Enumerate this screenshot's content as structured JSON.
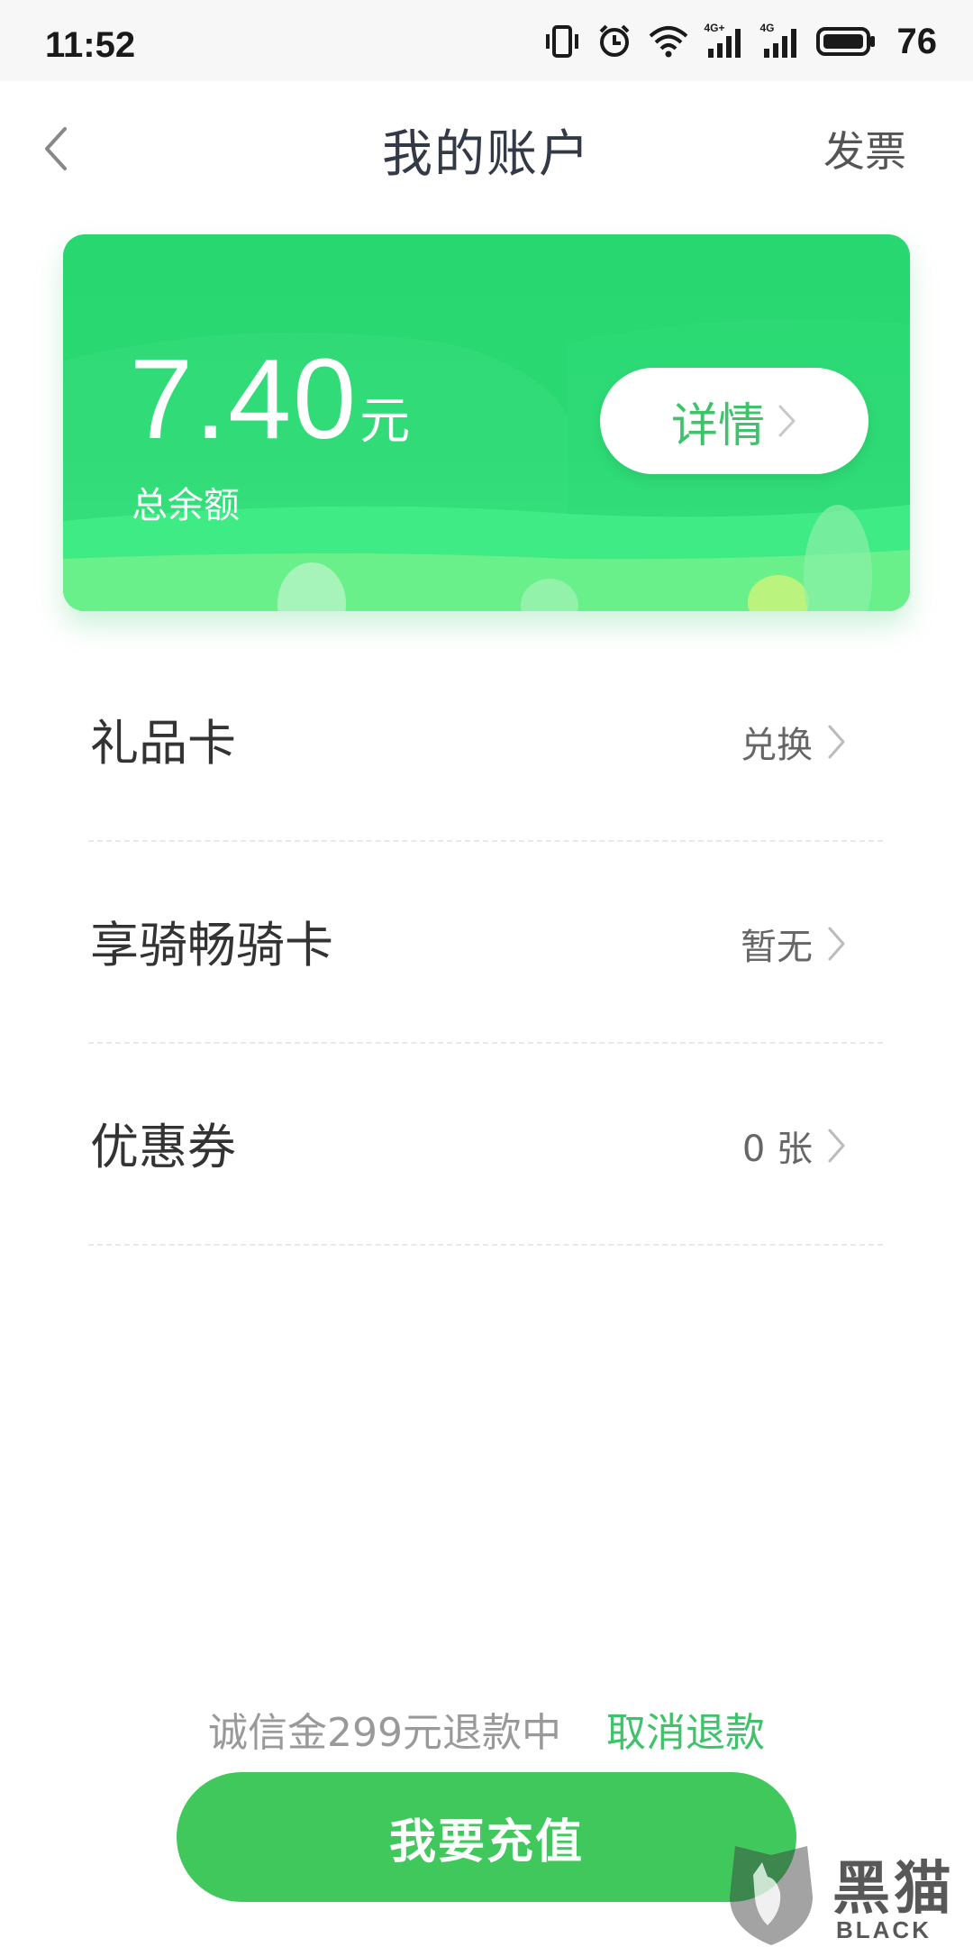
{
  "status_bar": {
    "time": "11:52",
    "network_1": "4G+",
    "network_2": "4G",
    "battery": "76"
  },
  "nav": {
    "title": "我的账户",
    "invoice": "发票"
  },
  "balance": {
    "amount": "7.40",
    "unit": "元",
    "label": "总余额",
    "detail_button": "详情"
  },
  "list": {
    "items": [
      {
        "label": "礼品卡",
        "value": "兑换"
      },
      {
        "label": "享骑畅骑卡",
        "value": "暂无"
      },
      {
        "label": "优惠券",
        "value": "0 张"
      }
    ]
  },
  "bottom": {
    "refund_status": "诚信金299元退款中",
    "cancel_refund": "取消退款",
    "recharge": "我要充值"
  },
  "watermark": {
    "cn": "黑猫",
    "en": "BLACK CAT"
  },
  "colors": {
    "accent_green": "#40c85d",
    "card_green": "#29d770",
    "link_green": "#3ec26a"
  }
}
